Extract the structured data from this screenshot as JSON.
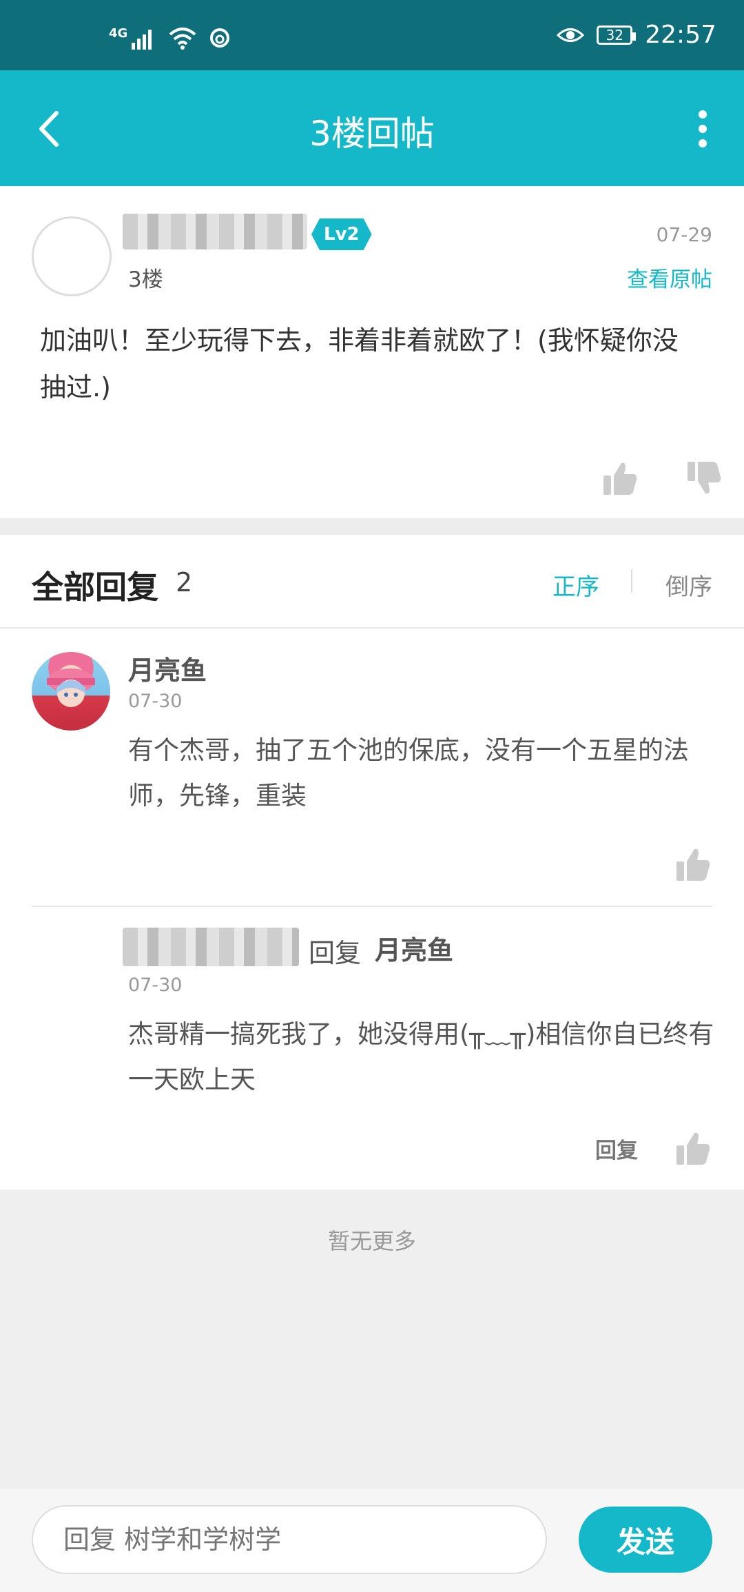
{
  "status_bar": {
    "network": "4G",
    "battery": "32",
    "time": "22:57"
  },
  "appbar": {
    "title": "3楼回帖"
  },
  "post": {
    "level_badge": "Lv2",
    "floor": "3楼",
    "date": "07-29",
    "view_original": "查看原帖",
    "content": "加油叭！至少玩得下去，非着非着就欧了！(我怀疑你没抽过.)"
  },
  "replies": {
    "title": "全部回复",
    "count": "2",
    "sort_asc": "正序",
    "sort_desc": "倒序",
    "items": [
      {
        "name": "月亮鱼",
        "date": "07-30",
        "content": "有个杰哥，抽了五个池的保底，没有一个五星的法师，先锋，重装"
      }
    ],
    "sub_reply": {
      "reply_label": "回复",
      "reply_target": "月亮鱼",
      "date": "07-30",
      "content": "杰哥精一搞死我了，她没得用(╥﹏╥)相信你自已终有一天欧上天",
      "action_reply": "回复"
    },
    "no_more": "暂无更多"
  },
  "bottom_bar": {
    "input_placeholder": "回复 树学和学树学",
    "send_label": "发送"
  },
  "colors": {
    "accent": "#14b8c8",
    "status_bar": "#0e6f7a"
  }
}
